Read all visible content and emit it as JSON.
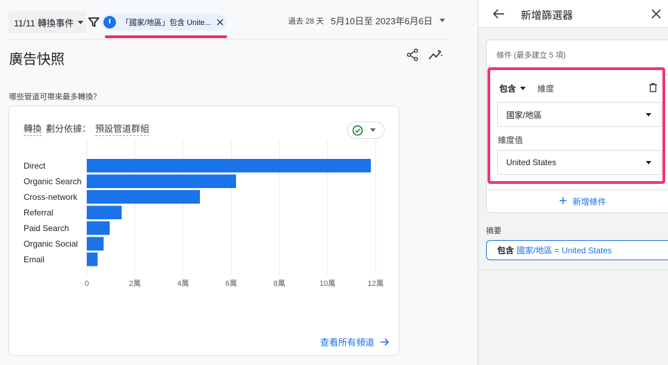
{
  "topbar": {
    "event_select": "11/11 轉換事件",
    "filter_chip": "「國家/地區」包含 Unite...",
    "date_range_label": "過去 28 天",
    "date_range_value": "5月10日至 2023年6月6日"
  },
  "page_title": "廣告快照",
  "question": "哪些管道可帶來最多轉換？",
  "chart_card": {
    "header_metric": "轉換",
    "header_by": "劃分依據：",
    "header_dimension": "預設管道群組",
    "view_all": "查看所有頻道",
    "bar_color": "#1a73e8",
    "check_color": "#188038"
  },
  "chart_data": {
    "type": "bar",
    "orientation": "horizontal",
    "categories": [
      "Direct",
      "Organic Search",
      "Cross-network",
      "Referral",
      "Paid Search",
      "Organic Social",
      "Email"
    ],
    "values": [
      118000,
      62000,
      47000,
      14500,
      9500,
      7000,
      4500
    ],
    "xlim": [
      0,
      120000
    ],
    "x_ticks": [
      0,
      20000,
      40000,
      60000,
      80000,
      100000,
      120000
    ],
    "x_tick_labels": [
      "0",
      "2萬",
      "4萬",
      "6萬",
      "8萬",
      "10萬",
      "12萬"
    ],
    "grid": "vertical"
  },
  "panel": {
    "title": "新增篩選器",
    "condition_hint": "條件 (最多建立 5 項)",
    "include_label": "包含",
    "dimension_label": "維度",
    "dimension_value": "國家/地區",
    "value_label": "維度值",
    "value_value": "United States",
    "add_condition": "新增條件",
    "summary_label": "摘要",
    "summary_prefix": "包含",
    "summary_expr": "國家/地區 = United States",
    "highlight_color": "#f1356f"
  }
}
